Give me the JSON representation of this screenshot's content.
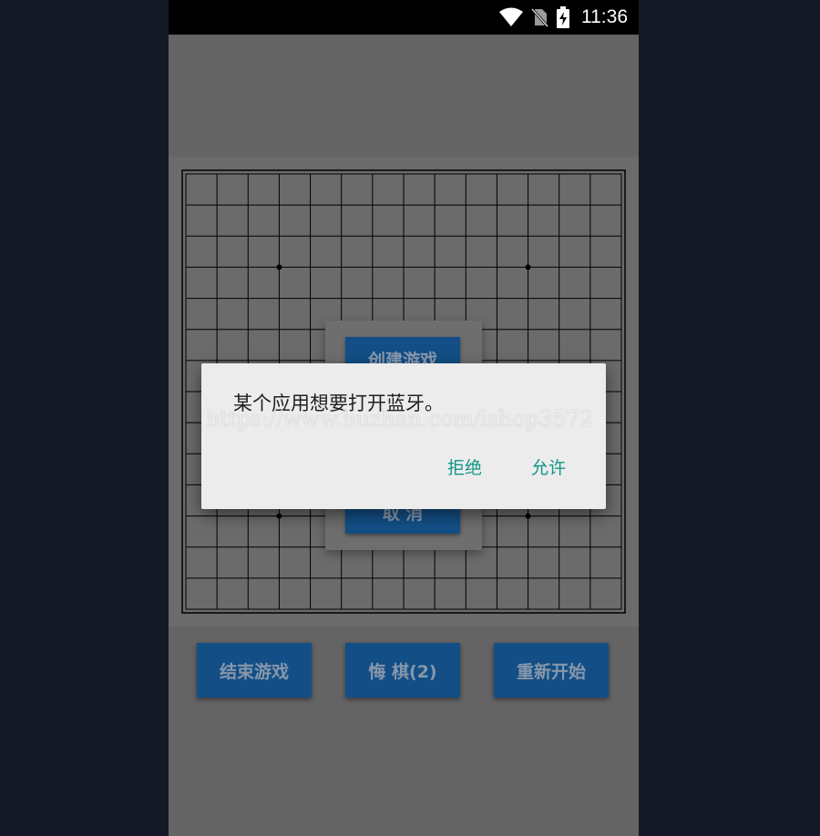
{
  "status_bar": {
    "time": "11:36"
  },
  "game_menu": {
    "create_label": "创建游戏",
    "cancel_label": "取 消"
  },
  "bottom_buttons": [
    {
      "label": "结束游戏"
    },
    {
      "label": "悔 棋(2)"
    },
    {
      "label": "重新开始"
    }
  ],
  "dialog": {
    "message": "某个应用想要打开蓝牙。",
    "deny_label": "拒绝",
    "allow_label": "允许"
  },
  "watermark": {
    "text": "https://www.huzhan.com/ishop3572"
  },
  "icons": {
    "wifi": "wifi-icon",
    "sim": "no-sim-icon",
    "battery": "battery-charging-icon"
  }
}
